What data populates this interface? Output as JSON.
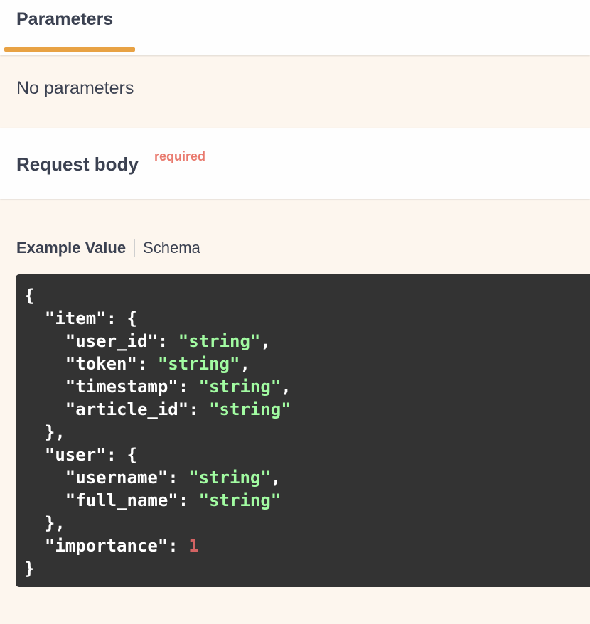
{
  "tabs": {
    "active_label": "Parameters",
    "accent_color": "#e8a244"
  },
  "parameters": {
    "empty_text": "No parameters"
  },
  "request_body": {
    "title": "Request body",
    "required_label": "required",
    "required_color": "#e97a6e"
  },
  "example_tabs": {
    "example_label": "Example Value",
    "schema_label": "Schema"
  },
  "example_json": {
    "open_brace": "{",
    "close_brace": "}",
    "item_key": "\"item\"",
    "user_key": "\"user\"",
    "user_id_key": "\"user_id\"",
    "token_key": "\"token\"",
    "timestamp_key": "\"timestamp\"",
    "article_id_key": "\"article_id\"",
    "username_key": "\"username\"",
    "full_name_key": "\"full_name\"",
    "importance_key": "\"importance\"",
    "string_value": "\"string\"",
    "importance_value": "1"
  }
}
